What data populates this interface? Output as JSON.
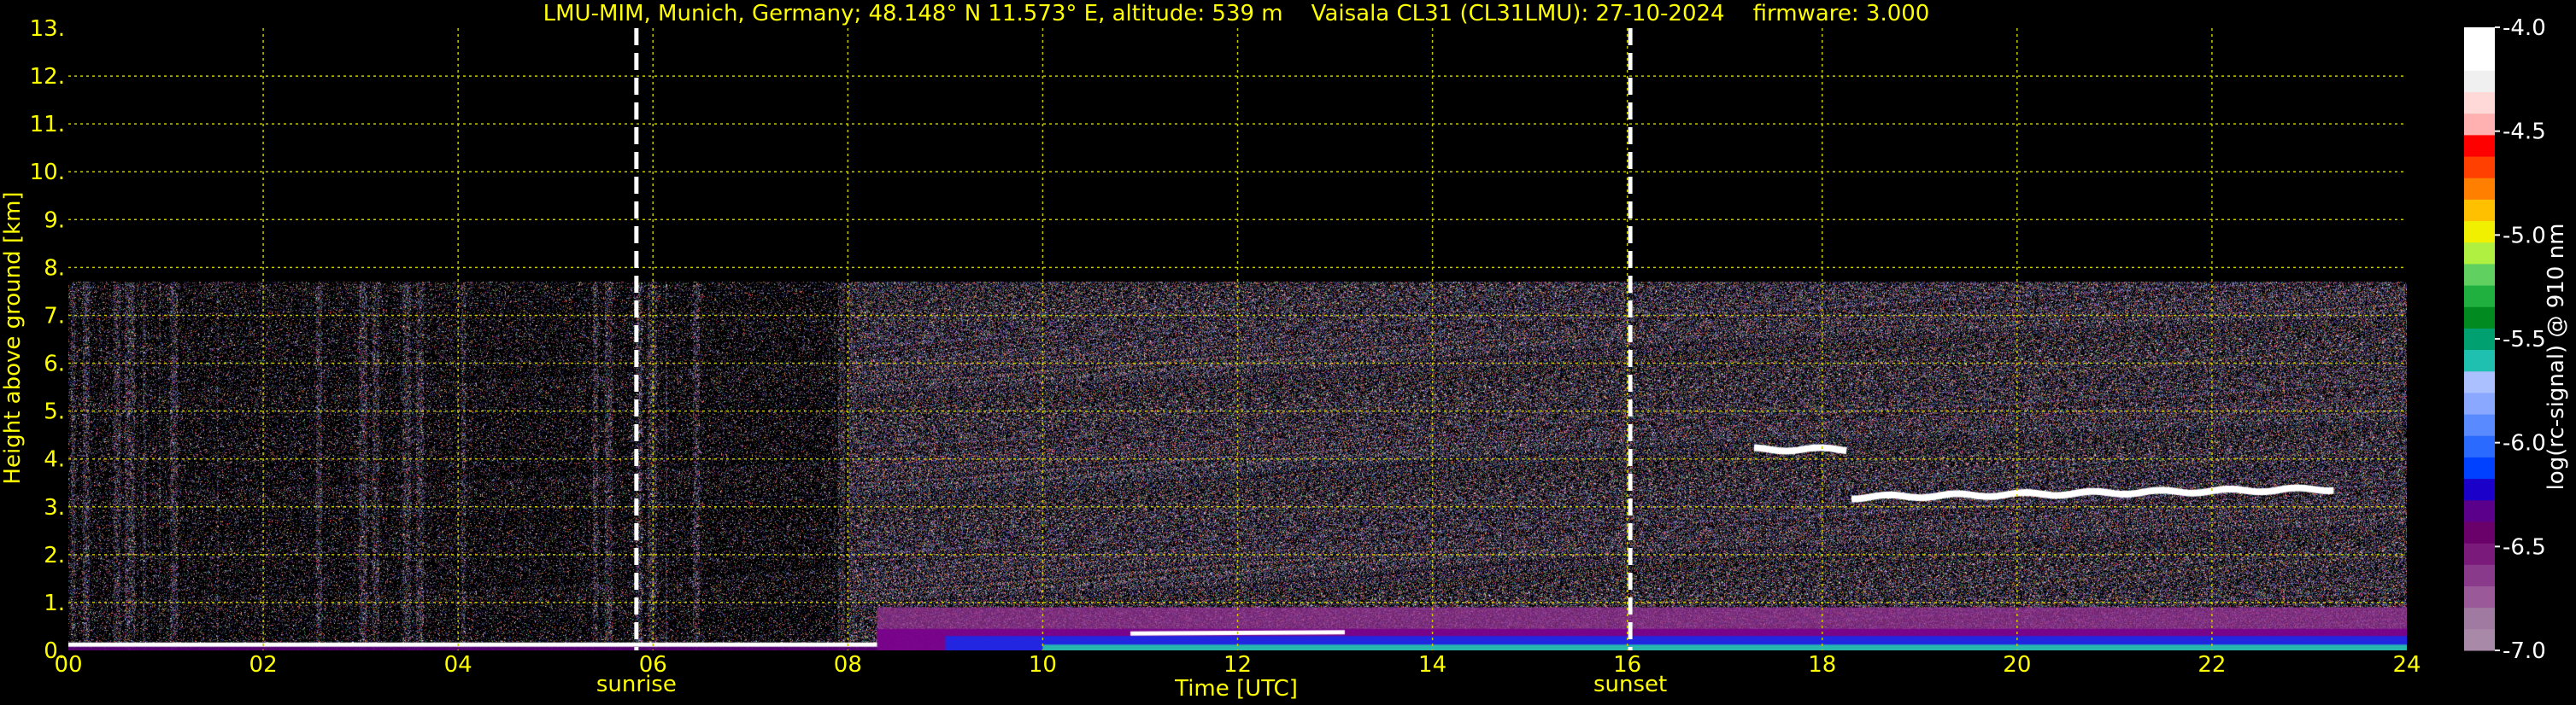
{
  "chart_data": {
    "type": "heatmap",
    "title": "LMU-MIM, Munich, Germany; 48.148° N 11.573° E, altitude: 539 m    Vaisala CL31 (CL31LMU): 27-10-2024    firmware: 3.000",
    "xlabel": "Time [UTC]",
    "ylabel": "Height above ground [km]",
    "xlim": [
      0,
      24
    ],
    "ylim": [
      0,
      13
    ],
    "x_ticks": [
      "00",
      "02",
      "04",
      "06",
      "08",
      "10",
      "12",
      "14",
      "16",
      "18",
      "20",
      "22",
      "24"
    ],
    "y_ticks": [
      "0.",
      "1.",
      "2.",
      "3.",
      "4.",
      "5.",
      "6.",
      "7.",
      "8.",
      "9.",
      "10.",
      "11.",
      "12.",
      "13."
    ],
    "grid": true,
    "colorbar": {
      "label": "log(rc-signal) @ 910 nm",
      "range": [
        -7.0,
        -4.0
      ],
      "ticks": [
        "-4.0",
        "-4.5",
        "-5.0",
        "-5.5",
        "-6.0",
        "-6.5",
        "-7.0"
      ],
      "colors": [
        "#a88aa8",
        "#a07aa0",
        "#9a5a9a",
        "#8a3a8a",
        "#7a1a7a",
        "#6a006a",
        "#5a008a",
        "#1a00c8",
        "#0040ff",
        "#2a6aff",
        "#5a8aff",
        "#8aa8ff",
        "#aac0ff",
        "#20c0b0",
        "#00a070",
        "#008a20",
        "#20b040",
        "#60d060",
        "#b0f040",
        "#f0f000",
        "#ffc000",
        "#ff8000",
        "#ff4000",
        "#ff0000",
        "#ffb0b0",
        "#ffd8d8",
        "#f0f0f0",
        "#ffffff",
        "#ffffff"
      ]
    },
    "annotations": [
      {
        "label": "sunrise",
        "x": 5.83
      },
      {
        "label": "sunset",
        "x": 16.03
      }
    ],
    "signal_top_km": 7.7,
    "cloud_layers": [
      {
        "x_start": 17.3,
        "x_end": 18.3,
        "height_km": 4.2
      },
      {
        "x_start": 18.3,
        "x_end": 23.3,
        "height_km": 3.2
      }
    ],
    "colors": {
      "background": "#000000",
      "axis_text": "#ffff00",
      "grid": "#c8c800",
      "marker_line": "#ffffff",
      "colorbar_text": "#ffffff"
    }
  }
}
